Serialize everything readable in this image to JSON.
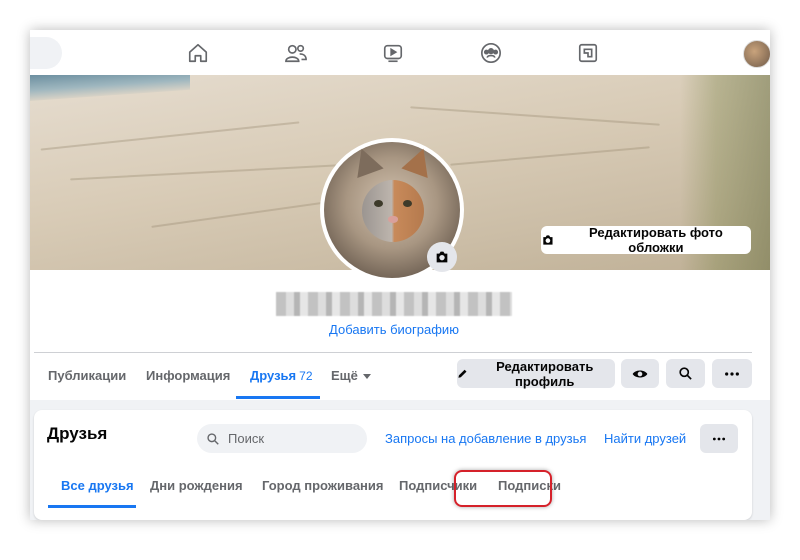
{
  "nav": {
    "icons": [
      "home-icon",
      "friends-icon",
      "watch-icon",
      "groups-icon",
      "gaming-icon"
    ]
  },
  "cover": {
    "edit_cover_label": "Редактировать фото обложки"
  },
  "profile": {
    "add_bio_label": "Добавить биографию"
  },
  "tabs": [
    {
      "label": "Публикации"
    },
    {
      "label": "Информация"
    },
    {
      "label": "Друзья",
      "count": "72"
    },
    {
      "label": "Ещё"
    }
  ],
  "actions": {
    "edit_profile_label": "Редактировать профиль"
  },
  "friends": {
    "title": "Друзья",
    "search_placeholder": "Поиск",
    "requests_link": "Запросы на добавление в друзья",
    "find_link": "Найти друзей",
    "subtabs": [
      {
        "label": "Все друзья"
      },
      {
        "label": "Дни рождения"
      },
      {
        "label": "Город проживания"
      },
      {
        "label": "Подписчики"
      },
      {
        "label": "Подписки"
      }
    ]
  },
  "colors": {
    "accent": "#1877f2",
    "highlight": "#d5212a"
  }
}
